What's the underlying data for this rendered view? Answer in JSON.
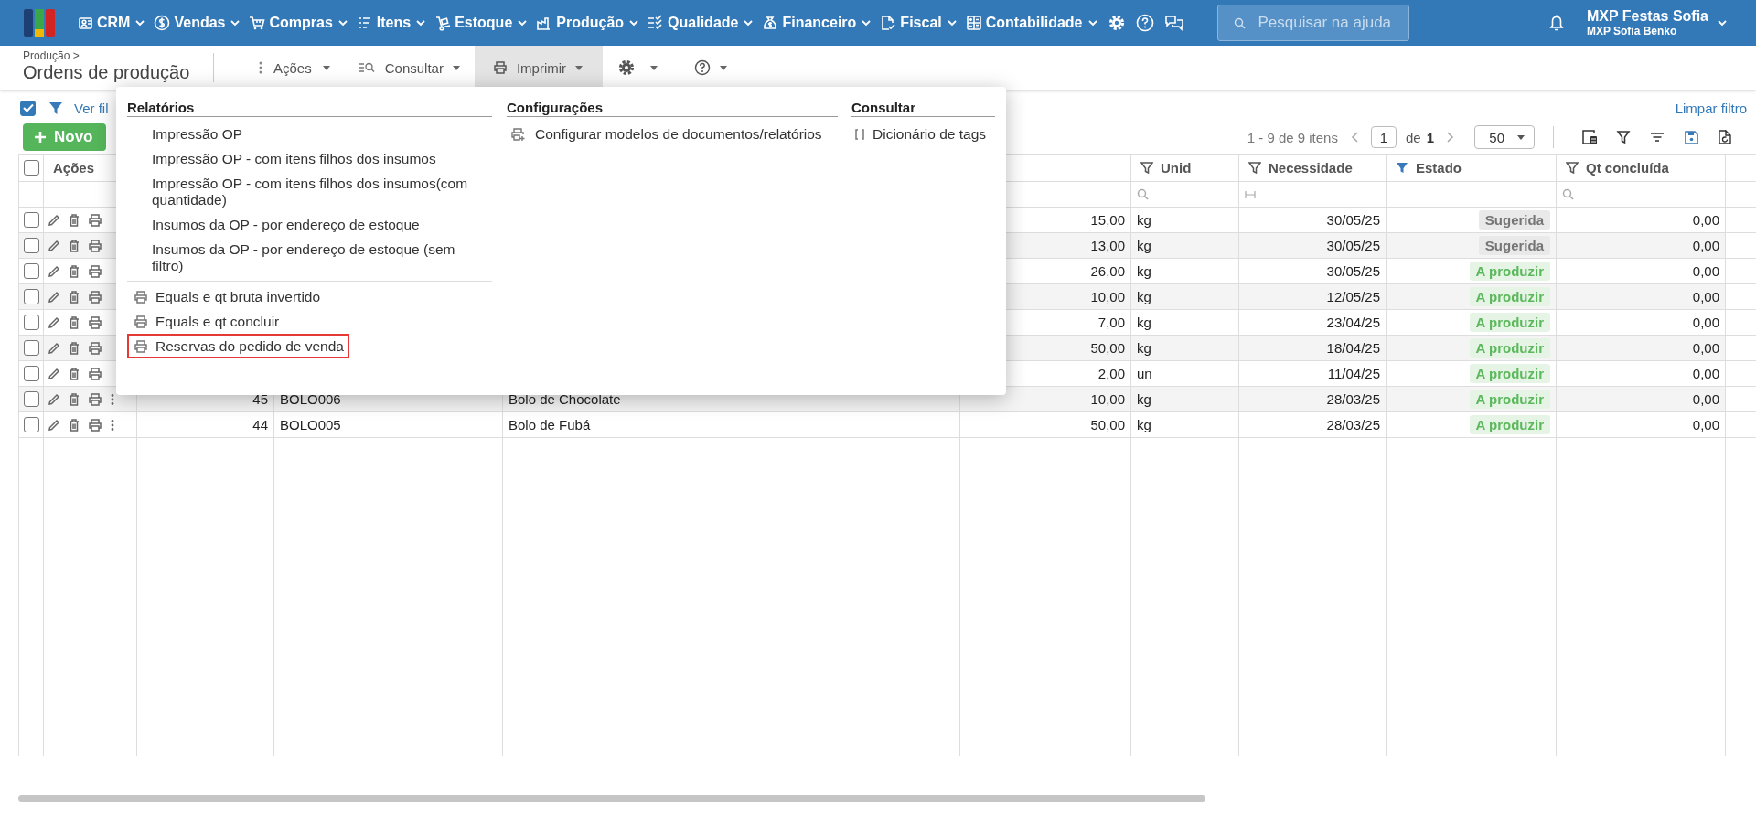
{
  "top_nav": {
    "menus": [
      {
        "label": "CRM"
      },
      {
        "label": "Vendas"
      },
      {
        "label": "Compras"
      },
      {
        "label": "Itens"
      },
      {
        "label": "Estoque"
      },
      {
        "label": "Produção"
      },
      {
        "label": "Qualidade"
      },
      {
        "label": "Financeiro"
      },
      {
        "label": "Fiscal"
      },
      {
        "label": "Contabilidade"
      }
    ],
    "search": {
      "placeholder": "Pesquisar na ajuda"
    },
    "user": {
      "name": "MXP Festas Sofia",
      "company": "MXP Sofia Benko"
    }
  },
  "page_header": {
    "breadcrumb": "Produção >",
    "title": "Ordens de produção",
    "toolbar": [
      {
        "kind": "actions",
        "label": "Ações",
        "selected": false
      },
      {
        "kind": "query",
        "label": "Consultar",
        "selected": false
      },
      {
        "kind": "print",
        "label": "Imprimir",
        "selected": true
      },
      {
        "kind": "settings",
        "selected": false
      },
      {
        "kind": "help",
        "selected": false
      }
    ]
  },
  "filter_bar": {
    "select_all_checked": true,
    "filter_link": "Ver fil",
    "clear_link": "Limpar filtro"
  },
  "new_button": "Novo",
  "pagination": {
    "range": "1 - 9 de 9 itens",
    "page": "1",
    "of": "de",
    "total_pages": "1",
    "page_size": "50"
  },
  "table": {
    "header_checked": false,
    "columns": [
      {
        "kind": "plain",
        "label": "Ações"
      },
      {
        "kind": "blank"
      },
      {
        "kind": "blank"
      },
      {
        "kind": "blank"
      },
      {
        "kind": "blank"
      },
      {
        "kind": "filterable",
        "label": "Unid",
        "filtered": false
      },
      {
        "kind": "filterable",
        "label": "Necessidade",
        "filtered": false
      },
      {
        "kind": "filterable",
        "label": "Estado",
        "filtered": true
      },
      {
        "kind": "filterable",
        "label": "Qt concluída",
        "filtered": false
      }
    ],
    "filter_row": [
      {
        "kind": "blank"
      },
      {
        "kind": "blank"
      },
      {
        "kind": "blank"
      },
      {
        "kind": "blank"
      },
      {
        "kind": "blank"
      },
      {
        "kind": "search"
      },
      {
        "kind": "range"
      },
      {
        "kind": "blank"
      },
      {
        "kind": "search"
      }
    ],
    "rows": [
      {
        "checked": false,
        "quantity": "15,00",
        "unit": "kg",
        "need_date": "30/05/25",
        "status": {
          "label": "Sugerida",
          "color": "#757575"
        },
        "done_qty": "0,00"
      },
      {
        "checked": false,
        "quantity": "13,00",
        "unit": "kg",
        "need_date": "30/05/25",
        "status": {
          "label": "Sugerida",
          "color": "#757575"
        },
        "done_qty": "0,00"
      },
      {
        "checked": false,
        "quantity": "26,00",
        "unit": "kg",
        "need_date": "30/05/25",
        "status": {
          "label": "A produzir",
          "color": "#5cb85c"
        },
        "done_qty": "0,00"
      },
      {
        "checked": false,
        "quantity": "10,00",
        "unit": "kg",
        "need_date": "12/05/25",
        "status": {
          "label": "A produzir",
          "color": "#5cb85c"
        },
        "done_qty": "0,00"
      },
      {
        "checked": false,
        "quantity": "7,00",
        "unit": "kg",
        "need_date": "23/04/25",
        "status": {
          "label": "A produzir",
          "color": "#5cb85c"
        },
        "done_qty": "0,00"
      },
      {
        "checked": false,
        "quantity": "50,00",
        "unit": "kg",
        "need_date": "18/04/25",
        "status": {
          "label": "A produzir",
          "color": "#5cb85c"
        },
        "done_qty": "0,00"
      },
      {
        "checked": false,
        "quantity": "2,00",
        "unit": "un",
        "need_date": "11/04/25",
        "status": {
          "label": "A produzir",
          "color": "#5cb85c"
        },
        "done_qty": "0,00"
      },
      {
        "checked": false,
        "number": "45",
        "code": "BOLO006",
        "description": "Bolo de Chocolate",
        "quantity": "10,00",
        "unit": "kg",
        "need_date": "28/03/25",
        "status": {
          "label": "A produzir",
          "color": "#5cb85c"
        },
        "done_qty": "0,00"
      },
      {
        "checked": false,
        "number": "44",
        "code": "BOLO005",
        "description": "Bolo de Fubá",
        "quantity": "50,00",
        "unit": "kg",
        "need_date": "28/03/25",
        "status": {
          "label": "A produzir",
          "color": "#5cb85c"
        },
        "done_qty": "0,00"
      }
    ]
  },
  "print_menu": {
    "sections": [
      {
        "title": "Relatórios",
        "items": [
          {
            "kind": "plain",
            "label": "Impressão OP",
            "highlighted": false
          },
          {
            "kind": "plain",
            "label": "Impressão OP - com itens filhos dos insumos",
            "highlighted": false
          },
          {
            "kind": "plain",
            "label": "Impressão OP - com itens filhos dos insumos(com quantidade)",
            "highlighted": false
          },
          {
            "kind": "plain",
            "label": "Insumos da OP - por endereço de estoque",
            "highlighted": false
          },
          {
            "kind": "plain",
            "label": "Insumos da OP - por endereço de estoque (sem filtro)",
            "highlighted": false
          },
          {
            "kind": "divider"
          },
          {
            "kind": "print",
            "label": "Equals e qt bruta invertido",
            "highlighted": false
          },
          {
            "kind": "print",
            "label": "Equals e qt concluir",
            "highlighted": false
          },
          {
            "kind": "print",
            "label": "Reservas do pedido de venda",
            "highlighted": true
          }
        ]
      },
      {
        "title": "Configurações",
        "items": [
          {
            "kind": "print_settings",
            "label": "Configurar modelos de documentos/relatórios",
            "highlighted": false
          }
        ]
      },
      {
        "title": "Consultar",
        "items": [
          {
            "kind": "brackets",
            "label": "Dicionário de tags",
            "highlighted": false
          }
        ]
      }
    ]
  }
}
